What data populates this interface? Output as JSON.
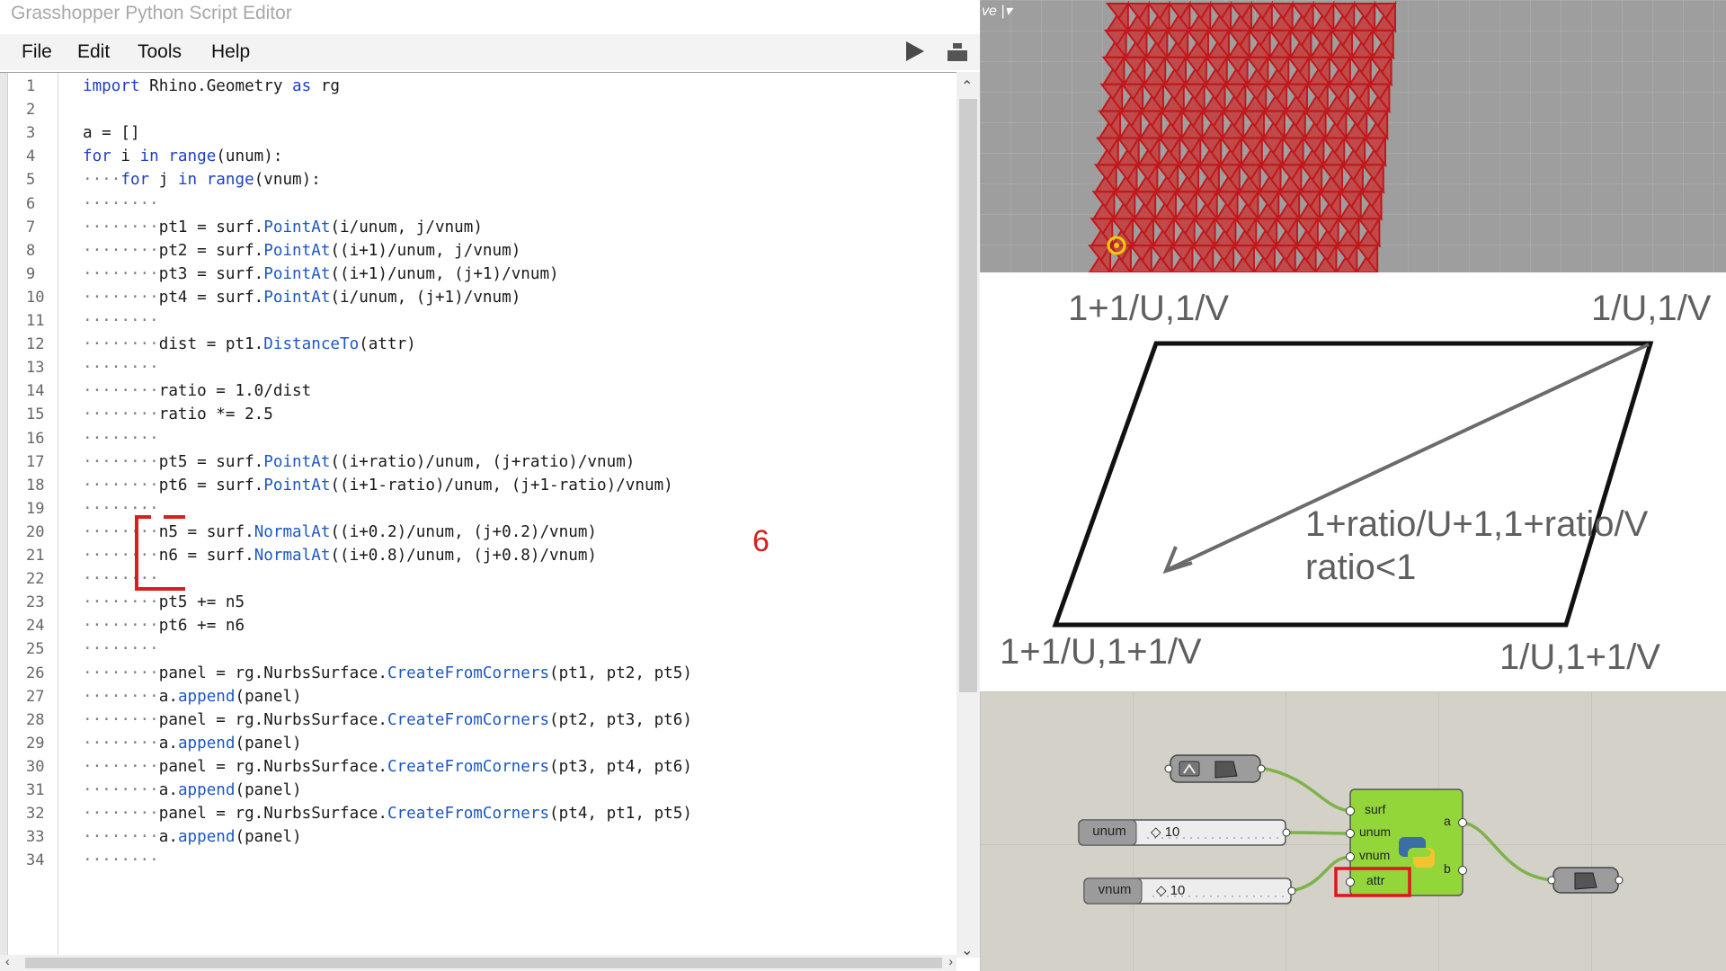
{
  "window": {
    "title": "Grasshopper Python Script Editor"
  },
  "menu": [
    "File",
    "Edit",
    "Tools",
    "Help"
  ],
  "toolbar": {
    "run_icon": "play-icon",
    "dock_icon": "dock-icon"
  },
  "editor": {
    "lines": [
      {
        "n": "1",
        "indent": "",
        "code": "import Rhino.Geometry as rg"
      },
      {
        "n": "2",
        "indent": "",
        "code": ""
      },
      {
        "n": "3",
        "indent": "",
        "code": "a = []"
      },
      {
        "n": "4",
        "indent": "",
        "code": "for i in range(unum):"
      },
      {
        "n": "5",
        "indent": "····",
        "code": "for j in range(vnum):"
      },
      {
        "n": "6",
        "indent": "········",
        "code": ""
      },
      {
        "n": "7",
        "indent": "········",
        "code": "pt1 = surf.PointAt(i/unum, j/vnum)"
      },
      {
        "n": "8",
        "indent": "········",
        "code": "pt2 = surf.PointAt((i+1)/unum, j/vnum)"
      },
      {
        "n": "9",
        "indent": "········",
        "code": "pt3 = surf.PointAt((i+1)/unum, (j+1)/vnum)"
      },
      {
        "n": "10",
        "indent": "········",
        "code": "pt4 = surf.PointAt(i/unum, (j+1)/vnum)"
      },
      {
        "n": "11",
        "indent": "········",
        "code": ""
      },
      {
        "n": "12",
        "indent": "········",
        "code": "dist = pt1.DistanceTo(attr)"
      },
      {
        "n": "13",
        "indent": "········",
        "code": ""
      },
      {
        "n": "14",
        "indent": "········",
        "code": "ratio = 1.0/dist"
      },
      {
        "n": "15",
        "indent": "········",
        "code": "ratio *= 2.5"
      },
      {
        "n": "16",
        "indent": "········",
        "code": ""
      },
      {
        "n": "17",
        "indent": "········",
        "code": "pt5 = surf.PointAt((i+ratio)/unum, (j+ratio)/vnum)"
      },
      {
        "n": "18",
        "indent": "········",
        "code": "pt6 = surf.PointAt((i+1-ratio)/unum, (j+1-ratio)/vnum)"
      },
      {
        "n": "19",
        "indent": "········",
        "code": ""
      },
      {
        "n": "20",
        "indent": "········",
        "code": "n5 = surf.NormalAt((i+0.2)/unum, (j+0.2)/vnum)"
      },
      {
        "n": "21",
        "indent": "········",
        "code": "n6 = surf.NormalAt((i+0.8)/unum, (j+0.8)/vnum)"
      },
      {
        "n": "22",
        "indent": "········",
        "code": ""
      },
      {
        "n": "23",
        "indent": "········",
        "code": "pt5 += n5"
      },
      {
        "n": "24",
        "indent": "········",
        "code": "pt6 += n6"
      },
      {
        "n": "25",
        "indent": "········",
        "code": ""
      },
      {
        "n": "26",
        "indent": "········",
        "code": "panel = rg.NurbsSurface.CreateFromCorners(pt1, pt2, pt5)"
      },
      {
        "n": "27",
        "indent": "········",
        "code": "a.append(panel)"
      },
      {
        "n": "28",
        "indent": "········",
        "code": "panel = rg.NurbsSurface.CreateFromCorners(pt2, pt3, pt6)"
      },
      {
        "n": "29",
        "indent": "········",
        "code": "a.append(panel)"
      },
      {
        "n": "30",
        "indent": "········",
        "code": "panel = rg.NurbsSurface.CreateFromCorners(pt3, pt4, pt6)"
      },
      {
        "n": "31",
        "indent": "········",
        "code": "a.append(panel)"
      },
      {
        "n": "32",
        "indent": "········",
        "code": "panel = rg.NurbsSurface.CreateFromCorners(pt4, pt1, pt5)"
      },
      {
        "n": "33",
        "indent": "········",
        "code": "a.append(panel)"
      },
      {
        "n": "34",
        "indent": "········",
        "code": ""
      }
    ],
    "annotation_number": "6"
  },
  "viewport": {
    "label": "ve",
    "dropdown_icon": "chevron-down-icon"
  },
  "diagram": {
    "top_left": "1+1/U,1/V",
    "top_right": "1/U,1/V",
    "bottom_left": "1+1/U,1+1/V",
    "bottom_right": "1/U,1+1/V",
    "vector_label": "1+ratio/U+1,1+ratio/V",
    "condition": "ratio<1"
  },
  "grasshopper": {
    "sliders": [
      {
        "name": "unum",
        "value": "10"
      },
      {
        "name": "vnum",
        "value": "10"
      }
    ],
    "component": {
      "inputs": [
        "surf",
        "unum",
        "vnum",
        "attr"
      ],
      "outputs": [
        "a",
        "b"
      ]
    },
    "colors": {
      "component": "#93d63a",
      "highlight": "#e0161c",
      "wire": "#7fb24a"
    }
  }
}
